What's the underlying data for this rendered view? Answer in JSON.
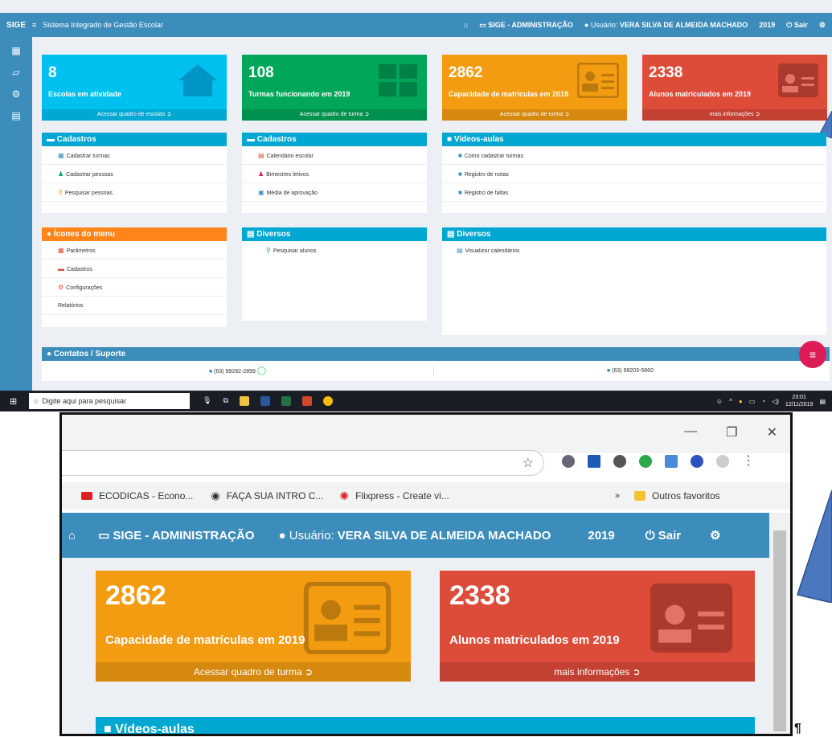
{
  "app": {
    "brand": "SIGE",
    "title": "Sistema Integrado de Gestão Escolar",
    "admin": "SIGE - ADMINISTRAÇÃO",
    "user_prefix": "Usuário:",
    "user_name": "VERA SILVA DE ALMEIDA MACHADO",
    "year": "2019",
    "logout": "Sair"
  },
  "boxes": [
    {
      "num": "8",
      "label": "Escolas em atividade",
      "footer": "Acessar quadro de escolas",
      "color": "#00c0ef"
    },
    {
      "num": "108",
      "label": "Turmas funcionando em 2019",
      "footer": "Acessar quadro de turma",
      "color": "#00a65a"
    },
    {
      "num": "2862",
      "label": "Capacidade de matrículas em 2019",
      "footer": "Acessar quadro de turma",
      "color": "#f39c12"
    },
    {
      "num": "2338",
      "label": "Alunos matriculados em 2019",
      "footer": "mais informações",
      "color": "#dd4b39"
    }
  ],
  "panels": {
    "cad1": {
      "title": "Cadastros",
      "items": [
        "Cadastrar turmas",
        "Cadastrar pessoas",
        "Pesquisar pessoas"
      ]
    },
    "cad2": {
      "title": "Cadastros",
      "items": [
        "Calendário escolar",
        "Bimestres letivos",
        "Média de aprovação"
      ]
    },
    "videos": {
      "title": "Vídeos-aulas",
      "items": [
        "Como cadastrar turmas",
        "Registro de notas",
        "Registro de faltas"
      ]
    },
    "menu": {
      "title": "Ícones do menu",
      "items": [
        "Parâmetros",
        "Cadastros",
        "Configurações",
        "Relatórios"
      ]
    },
    "div1": {
      "title": "Diversos",
      "items": [
        "Pesquisar alunos"
      ]
    },
    "div2": {
      "title": "Diversos",
      "items": [
        "Visualizar calendários"
      ]
    }
  },
  "contacts": {
    "title": "Contatos / Suporte",
    "phone1": "(63) 99282-2899",
    "phone2": "(63) 99203-5860"
  },
  "taskbar": {
    "search_placeholder": "Digite aqui para pesquisar",
    "time": "23:01",
    "date": "12/11/2019"
  },
  "browser": {
    "bookmarks": [
      "ECODICAS - Econo...",
      "FAÇA SUA INTRO C...",
      "Flixpress - Create vi..."
    ],
    "more": "»",
    "other_favs": "Outros favoritos"
  },
  "zoom": {
    "videos_title": "Vídeos-aulas"
  },
  "colors": {
    "header": "#3c8dbc",
    "aqua": "#00c0ef",
    "green": "#00a65a",
    "orange": "#f39c12",
    "red": "#dd4b39",
    "panel_orange": "#ff851b",
    "fab": "#dd1c57"
  }
}
